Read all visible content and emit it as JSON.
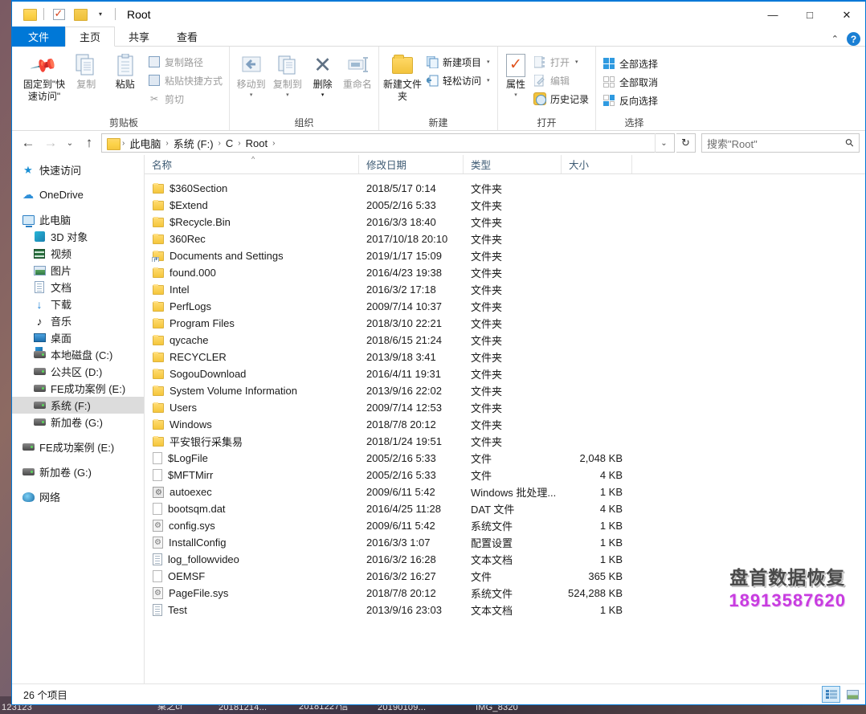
{
  "window": {
    "title": "Root",
    "minimize": "—",
    "maximize": "□",
    "close": "✕",
    "help": "?",
    "collapse_ribbon": "⌃"
  },
  "tabs": [
    {
      "label": "文件",
      "kind": "file"
    },
    {
      "label": "主页",
      "kind": "active"
    },
    {
      "label": "共享",
      "kind": "normal"
    },
    {
      "label": "查看",
      "kind": "normal"
    }
  ],
  "ribbon": {
    "groups": [
      {
        "label": "剪贴板",
        "big": [
          {
            "label": "固定到\"快速访问\"",
            "icon": "pin-icon",
            "disabled": false
          },
          {
            "label": "复制",
            "icon": "copy-icon",
            "disabled": true
          },
          {
            "label": "粘贴",
            "icon": "paste-icon",
            "disabled": false
          }
        ],
        "small": [
          {
            "label": "复制路径",
            "icon": "copy-path-icon",
            "disabled": true
          },
          {
            "label": "粘贴快捷方式",
            "icon": "paste-shortcut-icon",
            "disabled": true
          },
          {
            "label": "剪切",
            "icon": "scissors-icon",
            "disabled": true
          }
        ]
      },
      {
        "label": "组织",
        "big": [
          {
            "label": "移动到",
            "icon": "move-to-icon",
            "disabled": true,
            "dropdown": true
          },
          {
            "label": "复制到",
            "icon": "copy-to-icon",
            "disabled": true,
            "dropdown": true
          },
          {
            "label": "删除",
            "icon": "delete-icon",
            "disabled": false,
            "dropdown": true
          },
          {
            "label": "重命名",
            "icon": "rename-icon",
            "disabled": true
          }
        ],
        "small": []
      },
      {
        "label": "新建",
        "big": [
          {
            "label": "新建文件夹",
            "icon": "new-folder-icon",
            "disabled": false
          }
        ],
        "small": [
          {
            "label": "新建项目",
            "icon": "new-item-icon",
            "disabled": false,
            "dropdown": true
          },
          {
            "label": "轻松访问",
            "icon": "easy-access-icon",
            "disabled": false,
            "dropdown": true
          }
        ]
      },
      {
        "label": "打开",
        "big": [
          {
            "label": "属性",
            "icon": "properties-icon",
            "disabled": false,
            "dropdown": true
          }
        ],
        "small": [
          {
            "label": "打开",
            "icon": "open-icon",
            "disabled": true,
            "dropdown": true
          },
          {
            "label": "编辑",
            "icon": "edit-icon",
            "disabled": true
          },
          {
            "label": "历史记录",
            "icon": "history-icon",
            "disabled": false
          }
        ]
      },
      {
        "label": "选择",
        "big": [],
        "small": [
          {
            "label": "全部选择",
            "icon": "select-all-icon",
            "disabled": false
          },
          {
            "label": "全部取消",
            "icon": "deselect-all-icon",
            "disabled": false
          },
          {
            "label": "反向选择",
            "icon": "invert-selection-icon",
            "disabled": false
          }
        ]
      }
    ]
  },
  "nav": {
    "back": "←",
    "forward": "→",
    "recent": "⌄",
    "up": "↑",
    "dropdown": "⌄",
    "refresh": "↻",
    "breadcrumbs": [
      "此电脑",
      "系统 (F:)",
      "C",
      "Root"
    ],
    "separator": "›"
  },
  "search": {
    "placeholder": "搜索\"Root\"",
    "icon": "search-icon"
  },
  "sidebar": {
    "items": [
      {
        "label": "快速访问",
        "icon": "star-icon",
        "level": 0
      },
      {
        "label": "OneDrive",
        "icon": "cloud-icon",
        "level": 0,
        "gap_before": true
      },
      {
        "label": "此电脑",
        "icon": "computer-icon",
        "level": 0,
        "gap_before": true
      },
      {
        "label": "3D 对象",
        "icon": "cube-icon",
        "level": 1
      },
      {
        "label": "视频",
        "icon": "video-icon",
        "level": 1
      },
      {
        "label": "图片",
        "icon": "pictures-icon",
        "level": 1
      },
      {
        "label": "文档",
        "icon": "documents-icon",
        "level": 1
      },
      {
        "label": "下载",
        "icon": "downloads-icon",
        "level": 1
      },
      {
        "label": "音乐",
        "icon": "music-icon",
        "level": 1
      },
      {
        "label": "桌面",
        "icon": "desktop-icon",
        "level": 1
      },
      {
        "label": "本地磁盘 (C:)",
        "icon": "windows-drive-icon",
        "level": 1
      },
      {
        "label": "公共区 (D:)",
        "icon": "drive-icon",
        "level": 1
      },
      {
        "label": "FE成功案例 (E:)",
        "icon": "drive-icon",
        "level": 1
      },
      {
        "label": "系统 (F:)",
        "icon": "drive-icon",
        "level": 1,
        "selected": true
      },
      {
        "label": "新加卷 (G:)",
        "icon": "drive-icon",
        "level": 1
      },
      {
        "label": "FE成功案例 (E:)",
        "icon": "drive-icon",
        "level": 0,
        "gap_before": true
      },
      {
        "label": "新加卷 (G:)",
        "icon": "drive-icon",
        "level": 0,
        "gap_before": true
      },
      {
        "label": "网络",
        "icon": "network-icon",
        "level": 0,
        "gap_before": true
      }
    ]
  },
  "filelist": {
    "columns": [
      {
        "label": "名称",
        "key": "name",
        "sorted": true
      },
      {
        "label": "修改日期",
        "key": "date"
      },
      {
        "label": "类型",
        "key": "type"
      },
      {
        "label": "大小",
        "key": "size"
      }
    ],
    "rows": [
      {
        "name": "$360Section",
        "date": "2018/5/17 0:14",
        "type": "文件夹",
        "size": "",
        "icon": "folder-icon"
      },
      {
        "name": "$Extend",
        "date": "2005/2/16 5:33",
        "type": "文件夹",
        "size": "",
        "icon": "folder-icon"
      },
      {
        "name": "$Recycle.Bin",
        "date": "2016/3/3 18:40",
        "type": "文件夹",
        "size": "",
        "icon": "folder-icon"
      },
      {
        "name": "360Rec",
        "date": "2017/10/18 20:10",
        "type": "文件夹",
        "size": "",
        "icon": "folder-icon"
      },
      {
        "name": "Documents and Settings",
        "date": "2019/1/17 15:09",
        "type": "文件夹",
        "size": "",
        "icon": "folder-shortcut-icon"
      },
      {
        "name": "found.000",
        "date": "2016/4/23 19:38",
        "type": "文件夹",
        "size": "",
        "icon": "folder-icon"
      },
      {
        "name": "Intel",
        "date": "2016/3/2 17:18",
        "type": "文件夹",
        "size": "",
        "icon": "folder-icon"
      },
      {
        "name": "PerfLogs",
        "date": "2009/7/14 10:37",
        "type": "文件夹",
        "size": "",
        "icon": "folder-icon"
      },
      {
        "name": "Program Files",
        "date": "2018/3/10 22:21",
        "type": "文件夹",
        "size": "",
        "icon": "folder-icon"
      },
      {
        "name": "qycache",
        "date": "2018/6/15 21:24",
        "type": "文件夹",
        "size": "",
        "icon": "folder-icon"
      },
      {
        "name": "RECYCLER",
        "date": "2013/9/18 3:41",
        "type": "文件夹",
        "size": "",
        "icon": "folder-icon"
      },
      {
        "name": "SogouDownload",
        "date": "2016/4/11 19:31",
        "type": "文件夹",
        "size": "",
        "icon": "folder-icon"
      },
      {
        "name": "System Volume Information",
        "date": "2013/9/16 22:02",
        "type": "文件夹",
        "size": "",
        "icon": "folder-icon"
      },
      {
        "name": "Users",
        "date": "2009/7/14 12:53",
        "type": "文件夹",
        "size": "",
        "icon": "folder-icon"
      },
      {
        "name": "Windows",
        "date": "2018/7/8 20:12",
        "type": "文件夹",
        "size": "",
        "icon": "folder-icon"
      },
      {
        "name": "平安银行采集易",
        "date": "2018/1/24 19:51",
        "type": "文件夹",
        "size": "",
        "icon": "folder-icon"
      },
      {
        "name": "$LogFile",
        "date": "2005/2/16 5:33",
        "type": "文件",
        "size": "2,048 KB",
        "icon": "file-icon"
      },
      {
        "name": "$MFTMirr",
        "date": "2005/2/16 5:33",
        "type": "文件",
        "size": "4 KB",
        "icon": "file-icon"
      },
      {
        "name": "autoexec",
        "date": "2009/6/11 5:42",
        "type": "Windows 批处理...",
        "size": "1 KB",
        "icon": "batch-file-icon"
      },
      {
        "name": "bootsqm.dat",
        "date": "2016/4/25 11:28",
        "type": "DAT 文件",
        "size": "4 KB",
        "icon": "file-icon"
      },
      {
        "name": "config.sys",
        "date": "2009/6/11 5:42",
        "type": "系统文件",
        "size": "1 KB",
        "icon": "system-file-icon"
      },
      {
        "name": "InstallConfig",
        "date": "2016/3/3 1:07",
        "type": "配置设置",
        "size": "1 KB",
        "icon": "settings-file-icon"
      },
      {
        "name": "log_followvideo",
        "date": "2016/3/2 16:28",
        "type": "文本文档",
        "size": "1 KB",
        "icon": "text-file-icon"
      },
      {
        "name": "OEMSF",
        "date": "2016/3/2 16:27",
        "type": "文件",
        "size": "365 KB",
        "icon": "file-icon"
      },
      {
        "name": "PageFile.sys",
        "date": "2018/7/8 20:12",
        "type": "系统文件",
        "size": "524,288 KB",
        "icon": "system-file-icon"
      },
      {
        "name": "Test",
        "date": "2013/9/16 23:03",
        "type": "文本文档",
        "size": "1 KB",
        "icon": "text-file-icon"
      }
    ]
  },
  "watermark": {
    "line1": "盘首数据恢复",
    "line2": "18913587620"
  },
  "statusbar": {
    "item_count": "26 个项目",
    "views": [
      {
        "name": "details-view",
        "active": true
      },
      {
        "name": "large-icons-view",
        "active": false
      }
    ]
  },
  "desktop": {
    "taskrow": [
      "123123",
      "桌之cr",
      "20181214...",
      "20181227信",
      "20190109...",
      "IMG_8320"
    ]
  }
}
